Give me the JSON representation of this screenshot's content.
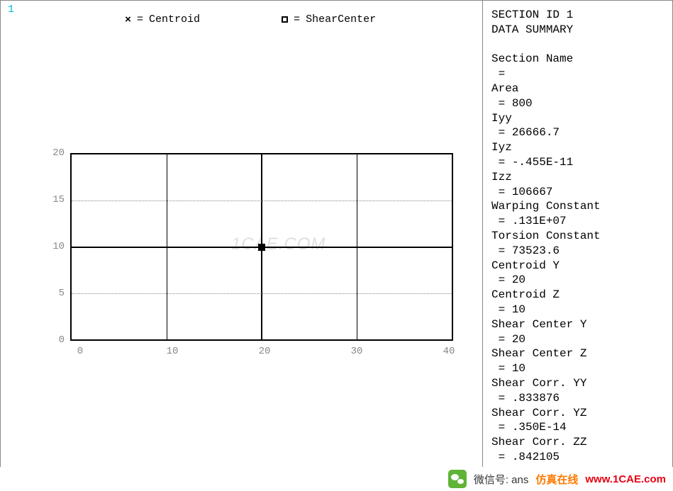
{
  "window_number": "1",
  "legend": {
    "centroid": {
      "eq": "=",
      "label": "Centroid"
    },
    "shear": {
      "eq": "=",
      "label": "ShearCenter"
    }
  },
  "axes": {
    "y": [
      "20",
      "15",
      "10",
      "5",
      "0"
    ],
    "x": [
      "0",
      "10",
      "20",
      "30",
      "40"
    ]
  },
  "watermark_center": "1CAE.COM",
  "summary": {
    "title1": "SECTION ID 1",
    "title2": "DATA SUMMARY",
    "rows": [
      {
        "k": "Section Name",
        "v": ""
      },
      {
        "k": "Area",
        "v": "800"
      },
      {
        "k": "Iyy",
        "v": "26666.7"
      },
      {
        "k": "Iyz",
        "v": "-.455E-11"
      },
      {
        "k": "Izz",
        "v": "106667"
      },
      {
        "k": "Warping Constant",
        "v": ".131E+07"
      },
      {
        "k": "Torsion Constant",
        "v": "73523.6"
      },
      {
        "k": "Centroid Y",
        "v": "20"
      },
      {
        "k": "Centroid Z",
        "v": "10"
      },
      {
        "k": "Shear Center Y",
        "v": "20"
      },
      {
        "k": "Shear Center Z",
        "v": "10"
      },
      {
        "k": "Shear Corr. YY",
        "v": ".833876"
      },
      {
        "k": "Shear Corr. YZ",
        "v": ".350E-14"
      },
      {
        "k": "Shear Corr. ZZ",
        "v": ".842105"
      }
    ]
  },
  "footer": {
    "wechat_label": "微信号:",
    "wechat_account": "ans",
    "brand_cn": "仿真在线",
    "brand_url": "www.1CAE.com"
  },
  "chart_data": {
    "type": "diagram",
    "title": "Beam cross-section mesh preview",
    "xlabel": "",
    "ylabel": "",
    "xlim": [
      0,
      40
    ],
    "ylim": [
      0,
      20
    ],
    "rectangle": {
      "xmin": 0,
      "xmax": 40,
      "ymin": 0,
      "ymax": 20
    },
    "mesh_divisions": {
      "x": 4,
      "y": 2
    },
    "markers": [
      {
        "name": "Centroid",
        "symbol": "x",
        "x": 20,
        "y": 10
      },
      {
        "name": "ShearCenter",
        "symbol": "square",
        "x": 20,
        "y": 10
      }
    ]
  }
}
